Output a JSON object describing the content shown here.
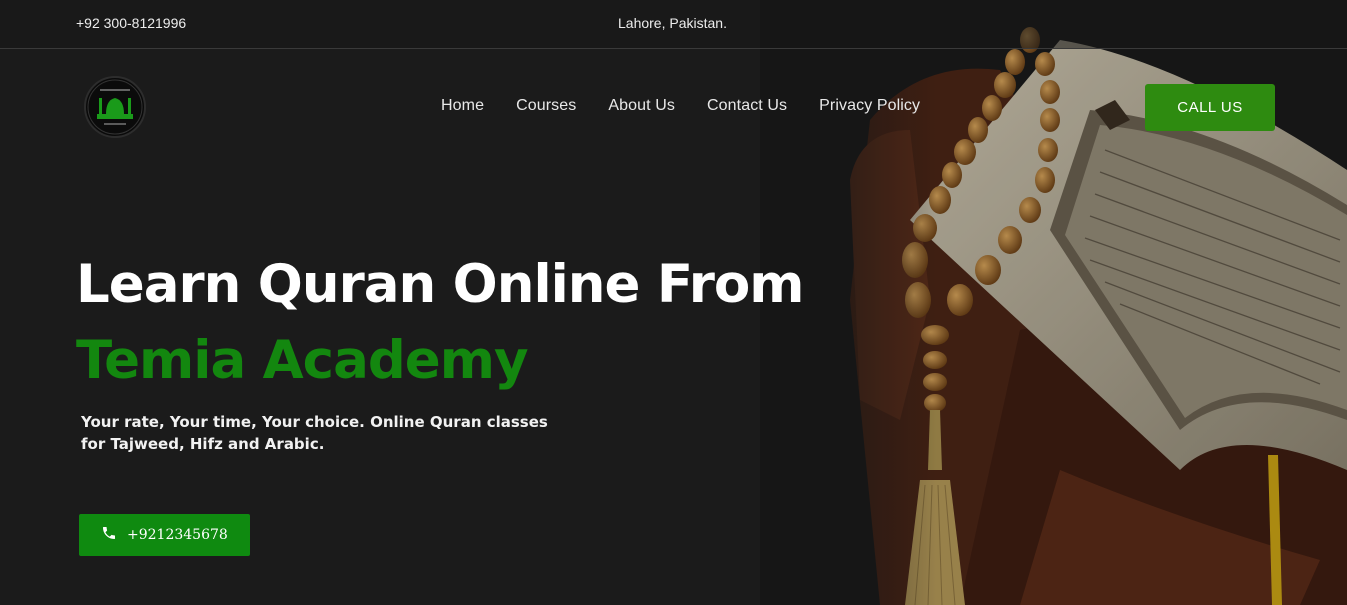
{
  "topbar": {
    "phone": "+92 300-8121996",
    "location": "Lahore, Pakistan."
  },
  "logo": {
    "icon": "mosque-logo-icon"
  },
  "nav": {
    "items": [
      {
        "label": "Home"
      },
      {
        "label": "Courses"
      },
      {
        "label": "About Us"
      },
      {
        "label": "Contact Us"
      },
      {
        "label": "Privacy Policy"
      }
    ]
  },
  "header": {
    "call_label": "CALL US"
  },
  "hero": {
    "title_line1": "Learn Quran Online From",
    "title_line2": "Temia Academy",
    "subtitle": "Your rate, Your time, Your choice. Online Quran classes for Tajweed, Hifz and Arabic.",
    "phone_button": "+9212345678",
    "phone_icon": "phone-icon",
    "image_subject": "quran-on-stand-with-prayer-beads"
  },
  "colors": {
    "background": "#1b1b1b",
    "brand_green": "#13870f",
    "button_green": "#2e8b10"
  }
}
